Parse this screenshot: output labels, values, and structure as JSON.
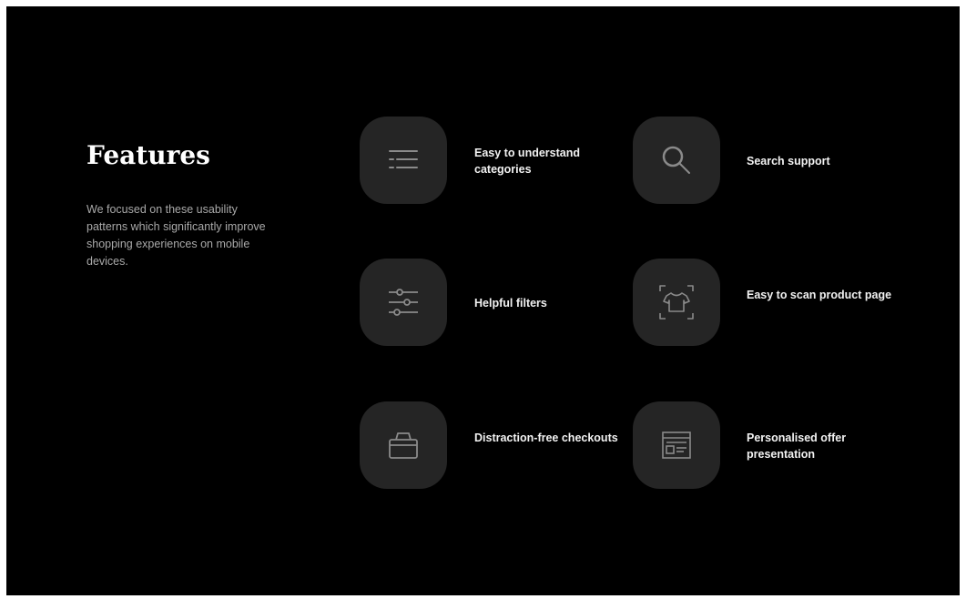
{
  "section": {
    "title": "Features",
    "description": "We focused on these usability patterns which significantly improve shopping experiences on mobile devices."
  },
  "features": [
    {
      "icon": "list-categories-icon",
      "label": "Easy to understand categories"
    },
    {
      "icon": "search-icon",
      "label": "Search support"
    },
    {
      "icon": "sliders-filter-icon",
      "label": "Helpful filters"
    },
    {
      "icon": "shirt-scan-icon",
      "label": "Easy to scan product page"
    },
    {
      "icon": "basket-checkout-icon",
      "label": "Distraction-free checkouts"
    },
    {
      "icon": "offer-layout-icon",
      "label": "Personalised offer presentation"
    }
  ],
  "colors": {
    "background": "#000000",
    "tile": "#252525",
    "icon_stroke": "#8a8a8a",
    "text": "#f2f2f2",
    "muted_text": "#a9a9a9"
  }
}
